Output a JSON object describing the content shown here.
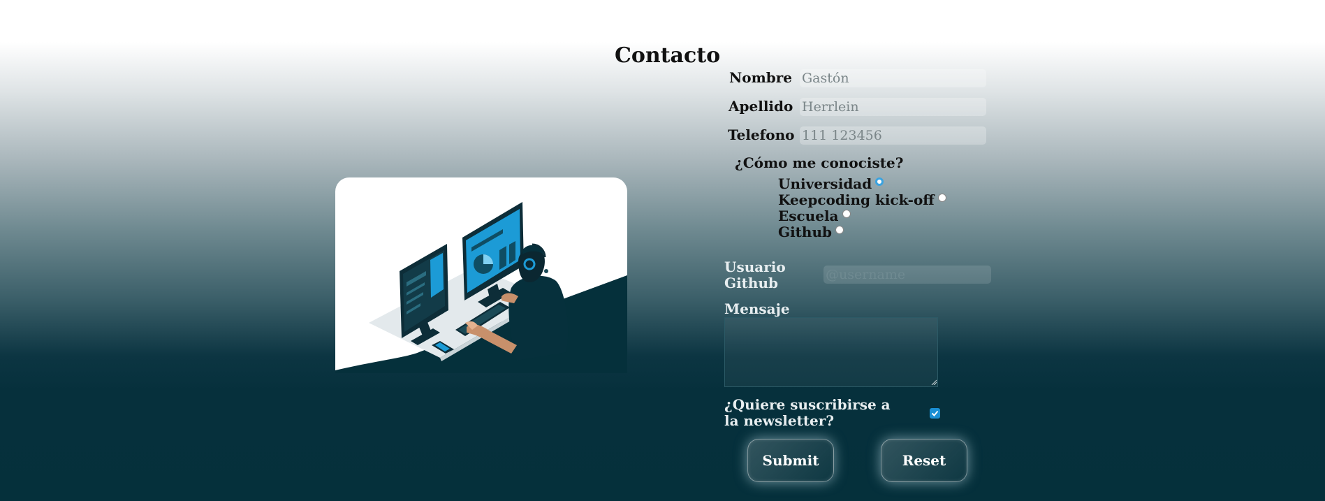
{
  "page": {
    "title": "Contacto"
  },
  "form": {
    "nombre": {
      "label": "Nombre",
      "placeholder": "Gastón"
    },
    "apellido": {
      "label": "Apellido",
      "placeholder": "Herrlein"
    },
    "telefono": {
      "label": "Telefono",
      "placeholder": "111 123456"
    },
    "how_found": {
      "question": "¿Cómo me conociste?",
      "options": [
        {
          "label": "Universidad",
          "selected": true
        },
        {
          "label": "Keepcoding kick-off",
          "selected": false
        },
        {
          "label": "Escuela",
          "selected": false
        },
        {
          "label": "Github",
          "selected": false
        }
      ]
    },
    "github": {
      "label_line1": "Usuario",
      "label_line2": "Github",
      "placeholder": "@username"
    },
    "mensaje": {
      "label": "Mensaje",
      "value": ""
    },
    "newsletter": {
      "label_line1": "¿Quiere suscribirse a",
      "label_line2": "la newsletter?",
      "checked": true
    },
    "buttons": {
      "submit": "Submit",
      "reset": "Reset"
    }
  },
  "colors": {
    "accent": "#1a8fd4",
    "dark_bg": "#05303b",
    "monitor_screen": "#1c9bd6"
  },
  "illustration": {
    "icon": "developer-at-computer-icon"
  }
}
